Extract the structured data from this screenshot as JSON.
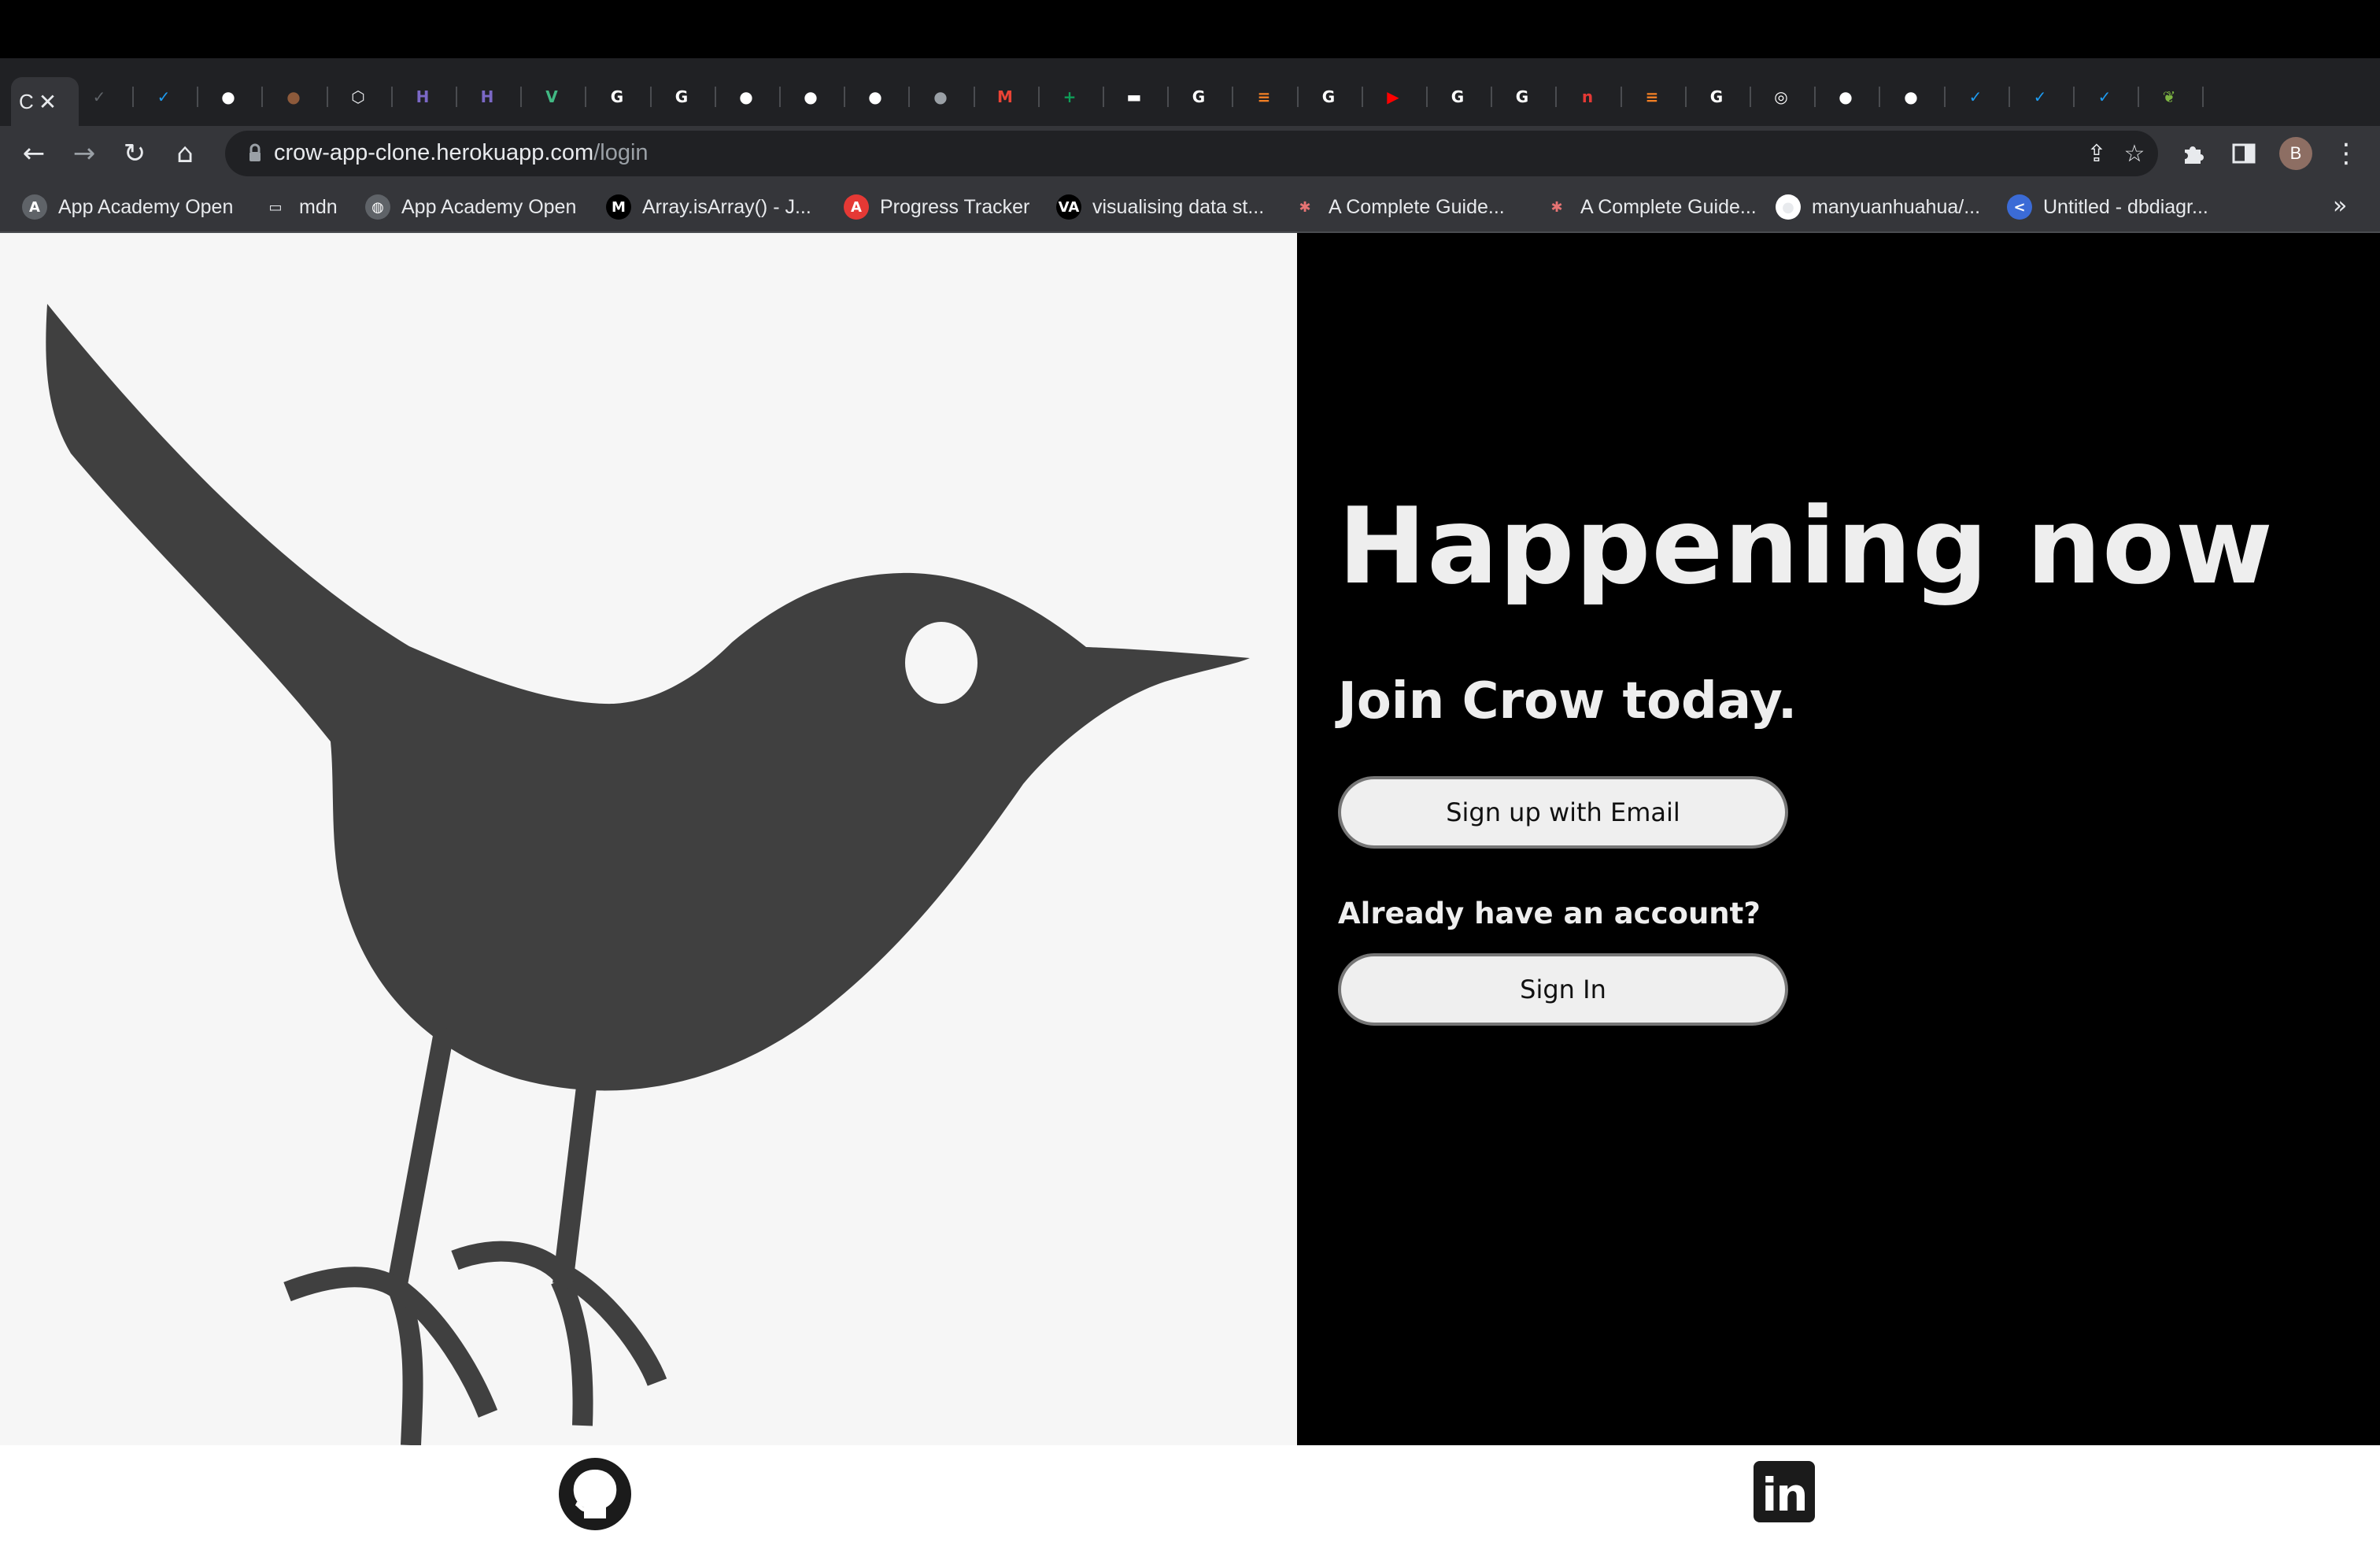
{
  "browser": {
    "active_tab": {
      "title_fragment": "C",
      "close_icon": "close-icon"
    },
    "tabs": [
      {
        "icon": "crow-icon",
        "color": "#5f6368",
        "glyph": "✓"
      },
      {
        "icon": "twitter-icon",
        "color": "#1d9bf0",
        "glyph": "✓"
      },
      {
        "icon": "github-icon",
        "color": "#ffffff",
        "glyph": "●"
      },
      {
        "icon": "avatar-photo-icon",
        "color": "#8d5a3b",
        "glyph": "●"
      },
      {
        "icon": "cube-icon",
        "color": "#e8eaed",
        "glyph": "⬡"
      },
      {
        "icon": "heroku-icon",
        "color": "#7b68c6",
        "glyph": "H"
      },
      {
        "icon": "heroku-icon",
        "color": "#7b68c6",
        "glyph": "H"
      },
      {
        "icon": "vue-icon",
        "color": "#41b883",
        "glyph": "V"
      },
      {
        "icon": "google-icon",
        "color": "#ffffff",
        "glyph": "G"
      },
      {
        "icon": "google-icon",
        "color": "#ffffff",
        "glyph": "G"
      },
      {
        "icon": "github-icon",
        "color": "#ffffff",
        "glyph": "●"
      },
      {
        "icon": "github-icon",
        "color": "#ffffff",
        "glyph": "●"
      },
      {
        "icon": "github-icon",
        "color": "#ffffff",
        "glyph": "●"
      },
      {
        "icon": "apple-icon",
        "color": "#9aa0a6",
        "glyph": "●"
      },
      {
        "icon": "gmail-icon",
        "color": "#ea4335",
        "glyph": "M"
      },
      {
        "icon": "sheets-icon",
        "color": "#0f9d58",
        "glyph": "+"
      },
      {
        "icon": "dictionary-icon",
        "color": "#ffffff",
        "glyph": "▬"
      },
      {
        "icon": "google-icon",
        "color": "#ffffff",
        "glyph": "G"
      },
      {
        "icon": "stackoverflow-icon",
        "color": "#f48024",
        "glyph": "≡"
      },
      {
        "icon": "google-icon",
        "color": "#ffffff",
        "glyph": "G"
      },
      {
        "icon": "youtube-icon",
        "color": "#ff0000",
        "glyph": "▶"
      },
      {
        "icon": "google-icon",
        "color": "#ffffff",
        "glyph": "G"
      },
      {
        "icon": "google-icon",
        "color": "#ffffff",
        "glyph": "G"
      },
      {
        "icon": "netlify-icon",
        "color": "#e53935",
        "glyph": "n"
      },
      {
        "icon": "stackoverflow-icon",
        "color": "#f48024",
        "glyph": "≡"
      },
      {
        "icon": "google-icon",
        "color": "#ffffff",
        "glyph": "G"
      },
      {
        "icon": "chrome-icon",
        "color": "#ffffff",
        "glyph": "◎"
      },
      {
        "icon": "github-icon",
        "color": "#ffffff",
        "glyph": "●"
      },
      {
        "icon": "github-icon",
        "color": "#ffffff",
        "glyph": "●"
      },
      {
        "icon": "twitter-icon",
        "color": "#1d9bf0",
        "glyph": "✓"
      },
      {
        "icon": "twitter-icon",
        "color": "#1d9bf0",
        "glyph": "✓"
      },
      {
        "icon": "twitter-icon",
        "color": "#1d9bf0",
        "glyph": "✓"
      },
      {
        "icon": "leaf-icon",
        "color": "#7cb342",
        "glyph": "❦"
      }
    ],
    "new_tab_label": "+",
    "tab_search_glyph": "⌄",
    "url_host": "crow-app-clone.herokuapp.com",
    "url_path": "/login",
    "profile_initial": "B"
  },
  "bookmarks": [
    {
      "label": "App Academy Open",
      "icon": "app-academy-icon",
      "color": "#5f6368",
      "glyph": "A"
    },
    {
      "label": "mdn",
      "icon": "folder-icon",
      "color": "transparent",
      "glyph": "▭"
    },
    {
      "label": "App Academy Open",
      "icon": "globe-icon",
      "color": "#5f6368",
      "glyph": "◍"
    },
    {
      "label": "Array.isArray() - J...",
      "icon": "mdn-icon",
      "color": "#000000",
      "glyph": "M"
    },
    {
      "label": "Progress Tracker",
      "icon": "progress-tracker-icon",
      "color": "#e53935",
      "glyph": "A"
    },
    {
      "label": "visualising data st...",
      "icon": "visualgo-icon",
      "color": "#000000",
      "glyph": "VA"
    },
    {
      "label": "A Complete Guide...",
      "icon": "asterisk-icon",
      "color": "transparent",
      "glyph": "✱"
    },
    {
      "label": "A Complete Guide...",
      "icon": "asterisk-icon",
      "color": "transparent",
      "glyph": "✱"
    },
    {
      "label": "manyuanhuahua/...",
      "icon": "github-icon",
      "color": "#ffffff",
      "glyph": "●"
    },
    {
      "label": "Untitled - dbdiagr...",
      "icon": "dbdiagram-icon",
      "color": "#3b6bd6",
      "glyph": "<"
    }
  ],
  "bookmarks_more": "»",
  "colors": {
    "hero_left_bg": "#f6f6f6",
    "hero_right_bg": "#000000",
    "bird": "#404040",
    "headline_text": "#eeeeee",
    "button_bg": "#efefef"
  },
  "hero": {
    "headline": "Happening now",
    "subheadline": "Join Crow today.",
    "signup_label": "Sign up with Email",
    "account_question": "Already have an account?",
    "signin_label": "Sign In",
    "illustration_icon": "crow-bird-icon"
  },
  "footer": {
    "github_icon": "github-icon",
    "linkedin_icon": "linkedin-icon",
    "linkedin_text": "in"
  }
}
